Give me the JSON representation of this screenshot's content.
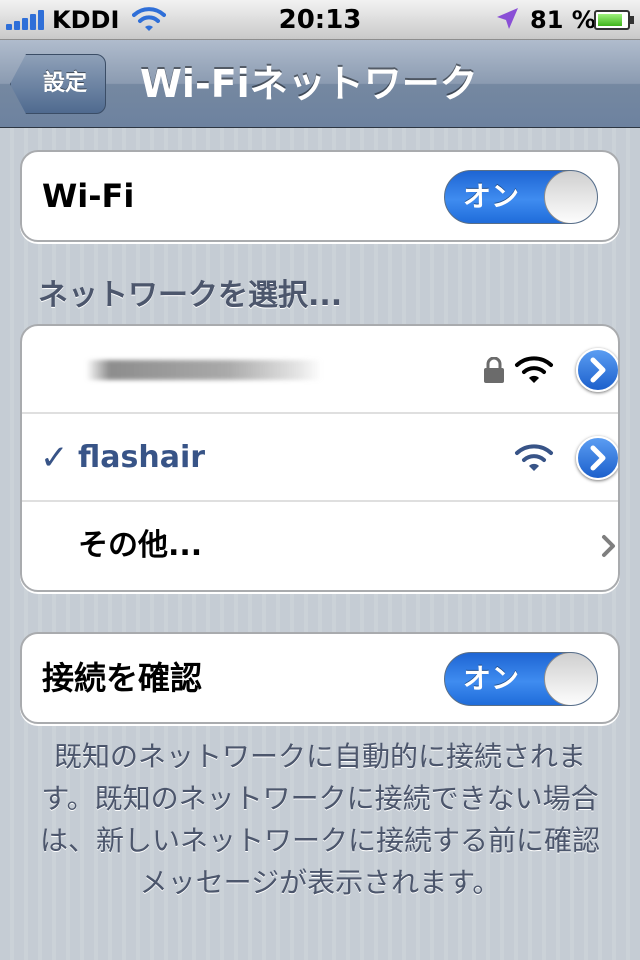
{
  "status_bar": {
    "carrier": "KDDI",
    "time": "20:13",
    "battery_percent": "81 %",
    "battery_level": 0.81,
    "signal_bars": 5
  },
  "nav": {
    "back_label": "設定",
    "title": "Wi-Fiネットワーク"
  },
  "wifi": {
    "label": "Wi-Fi",
    "toggle_label": "オン",
    "state": "on"
  },
  "networks_section": {
    "header": "ネットワークを選択...",
    "networks": [
      {
        "name": "",
        "locked": true,
        "connected": false,
        "icon": "wifi-signal-icon"
      },
      {
        "name": "flashair",
        "locked": false,
        "connected": true,
        "checkmark": "✓",
        "icon": "wifi-signal-icon"
      }
    ],
    "other_label": "その他..."
  },
  "ask_to_join": {
    "label": "接続を確認",
    "toggle_label": "オン",
    "state": "on"
  },
  "footer": {
    "note": "既知のネットワークに自動的に接続されます。既知のネットワークに接続できない場合は、新しいネットワークに接続する前に確認メッセージが表示されます。"
  },
  "colors": {
    "accent_blue": "#2f6fd8",
    "selected_text": "#385487",
    "section_text": "#4c566c"
  }
}
